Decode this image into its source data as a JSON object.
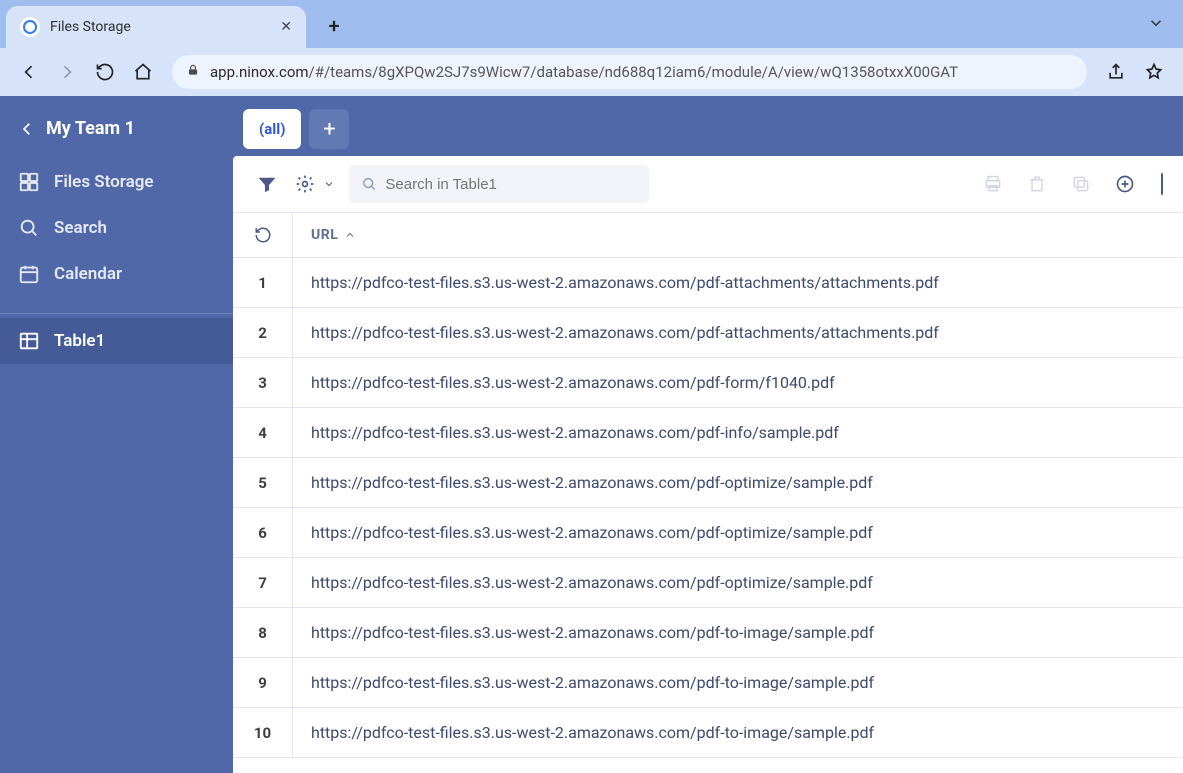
{
  "browser": {
    "tab_title": "Files Storage",
    "address_host": "app.ninox.com",
    "address_path": "/#/teams/8gXPQw2SJ7s9Wicw7/database/nd688q12iam6/module/A/view/wQ1358otxxX00GAT"
  },
  "sidebar": {
    "team_name": "My Team 1",
    "items": [
      {
        "label": "Files Storage"
      },
      {
        "label": "Search"
      },
      {
        "label": "Calendar"
      }
    ],
    "tables": [
      {
        "label": "Table1",
        "active": true
      }
    ]
  },
  "view_tabs": {
    "all_label": "(all)"
  },
  "toolbar": {
    "search_placeholder": "Search in Table1"
  },
  "table": {
    "column_label": "URL",
    "rows": [
      {
        "n": "1",
        "url": "https://pdfco-test-files.s3.us-west-2.amazonaws.com/pdf-attachments/attachments.pdf"
      },
      {
        "n": "2",
        "url": "https://pdfco-test-files.s3.us-west-2.amazonaws.com/pdf-attachments/attachments.pdf"
      },
      {
        "n": "3",
        "url": "https://pdfco-test-files.s3.us-west-2.amazonaws.com/pdf-form/f1040.pdf"
      },
      {
        "n": "4",
        "url": "https://pdfco-test-files.s3.us-west-2.amazonaws.com/pdf-info/sample.pdf"
      },
      {
        "n": "5",
        "url": "https://pdfco-test-files.s3.us-west-2.amazonaws.com/pdf-optimize/sample.pdf"
      },
      {
        "n": "6",
        "url": "https://pdfco-test-files.s3.us-west-2.amazonaws.com/pdf-optimize/sample.pdf"
      },
      {
        "n": "7",
        "url": "https://pdfco-test-files.s3.us-west-2.amazonaws.com/pdf-optimize/sample.pdf"
      },
      {
        "n": "8",
        "url": "https://pdfco-test-files.s3.us-west-2.amazonaws.com/pdf-to-image/sample.pdf"
      },
      {
        "n": "9",
        "url": "https://pdfco-test-files.s3.us-west-2.amazonaws.com/pdf-to-image/sample.pdf"
      },
      {
        "n": "10",
        "url": "https://pdfco-test-files.s3.us-west-2.amazonaws.com/pdf-to-image/sample.pdf"
      }
    ]
  }
}
